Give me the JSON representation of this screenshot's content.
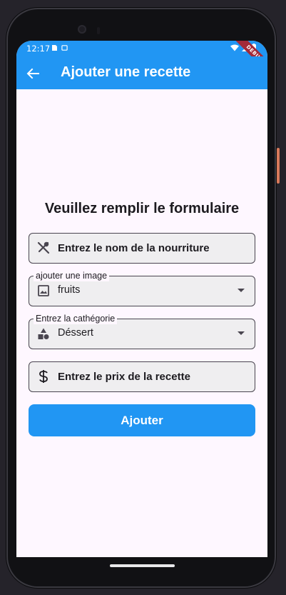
{
  "statusbar": {
    "time": "12:17",
    "debug_banner": "DEBUG"
  },
  "appbar": {
    "title": "Ajouter une recette",
    "back_icon": "arrow-back-icon"
  },
  "form": {
    "heading": "Veuillez remplir le formulaire",
    "food_name": {
      "placeholder": "Entrez le nom de la nourriture",
      "icon": "restaurant-icon"
    },
    "image": {
      "label": "ajouter une image",
      "value": "fruits",
      "icon": "image-icon"
    },
    "category": {
      "label": "Entrez la cathégorie",
      "value": "Déssert",
      "icon": "category-icon"
    },
    "price": {
      "placeholder": "Entrez le prix de la recette",
      "icon": "dollar-icon"
    },
    "submit_label": "Ajouter"
  },
  "colors": {
    "primary": "#2196f3",
    "surface": "#fef7ff",
    "field_fill": "#efeef0",
    "border": "#49454f",
    "debug": "#a32a3a"
  }
}
